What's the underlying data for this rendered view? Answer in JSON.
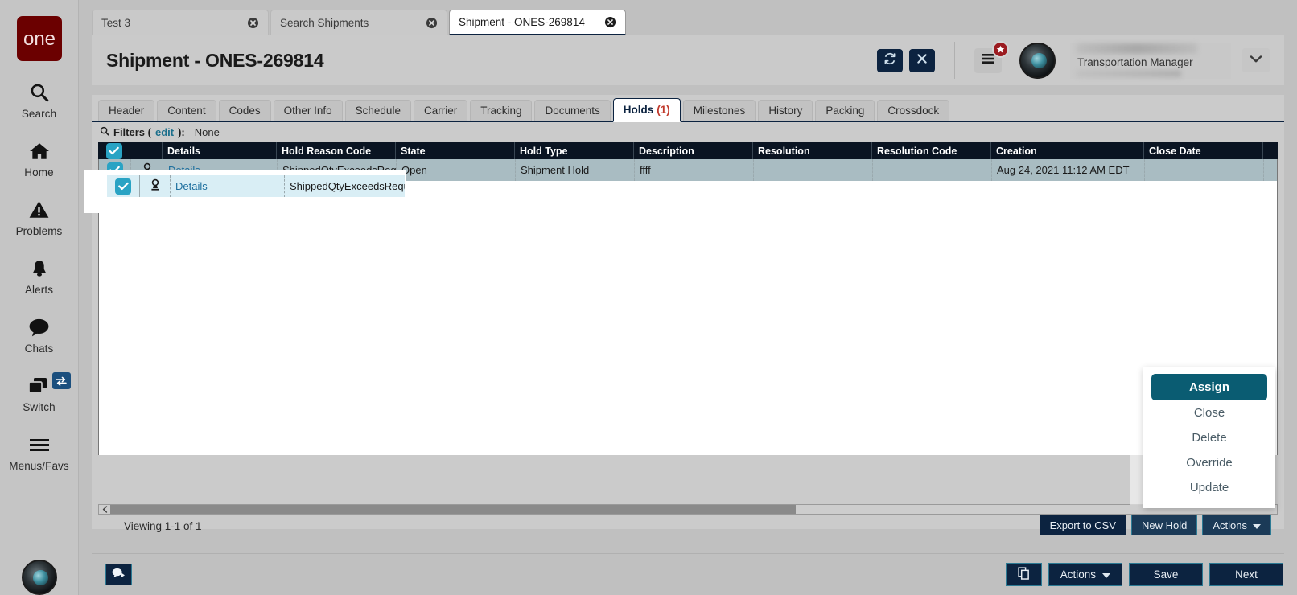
{
  "rail": {
    "logo_text": "one",
    "items": [
      {
        "label": "Search",
        "icon": "search-icon"
      },
      {
        "label": "Home",
        "icon": "home-icon"
      },
      {
        "label": "Problems",
        "icon": "warning-triangle-icon"
      },
      {
        "label": "Alerts",
        "icon": "bell-icon"
      },
      {
        "label": "Chats",
        "icon": "chat-bubble-icon"
      },
      {
        "label": "Switch",
        "icon": "windows-stack-icon",
        "badge_icon": "swap-arrows-icon"
      },
      {
        "label": "Menus/Favs",
        "icon": "hamburger-icon"
      }
    ],
    "bottom_icon": "user-avatar-icon"
  },
  "browser_tabs": [
    {
      "label": "Test 3",
      "active": false
    },
    {
      "label": "Search Shipments",
      "active": false
    },
    {
      "label": "Shipment - ONES-269814",
      "active": true
    }
  ],
  "header": {
    "title": "Shipment - ONES-269814",
    "refresh_icon": "refresh-icon",
    "close_icon": "close-x-icon",
    "menu_icon": "hamburger-menu-icon",
    "badge_icon": "star-badge-icon",
    "avatar_icon": "user-avatar-icon",
    "user_role": "Transportation Manager",
    "caret_icon": "chevron-down-icon"
  },
  "tabs": [
    {
      "label": "Header",
      "active": false,
      "count": ""
    },
    {
      "label": "Content",
      "active": false,
      "count": ""
    },
    {
      "label": "Codes",
      "active": false,
      "count": ""
    },
    {
      "label": "Other Info",
      "active": false,
      "count": ""
    },
    {
      "label": "Schedule",
      "active": false,
      "count": ""
    },
    {
      "label": "Carrier",
      "active": false,
      "count": ""
    },
    {
      "label": "Tracking",
      "active": false,
      "count": ""
    },
    {
      "label": "Documents",
      "active": false,
      "count": ""
    },
    {
      "label": "Holds",
      "active": true,
      "count": "(1)"
    },
    {
      "label": "Milestones",
      "active": false,
      "count": ""
    },
    {
      "label": "History",
      "active": false,
      "count": ""
    },
    {
      "label": "Packing",
      "active": false,
      "count": ""
    },
    {
      "label": "Crossdock",
      "active": false,
      "count": ""
    }
  ],
  "filters": {
    "icon": "search-icon",
    "label": "Filters (",
    "edit_link": "edit",
    "label_end": "):",
    "value": "None"
  },
  "grid": {
    "columns": [
      "Details",
      "Hold Reason Code",
      "State",
      "Hold Type",
      "Description",
      "Resolution",
      "Resolution Code",
      "Creation",
      "Close Date"
    ],
    "header_checkbox_checked": true,
    "rows": [
      {
        "checked": true,
        "row_icon": "stamp-icon",
        "details": "Details",
        "hold_reason_code": "ShippedQtyExceedsRequ...",
        "state": "Open",
        "hold_type": "Shipment Hold",
        "description": "ffff",
        "resolution": "",
        "resolution_code": "",
        "creation": "Aug 24, 2021 11:12 AM EDT",
        "close_date": ""
      }
    ],
    "viewing": "Viewing 1-1 of 1",
    "actions": {
      "export_label": "Export to CSV",
      "new_hold_label": "New Hold",
      "actions_label": "Actions",
      "caret_icon": "chevron-down-icon"
    },
    "scroll_left_icon": "chevron-left-icon"
  },
  "dropdown": {
    "items": [
      {
        "label": "Assign",
        "selected": true
      },
      {
        "label": "Close",
        "selected": false
      },
      {
        "label": "Delete",
        "selected": false
      },
      {
        "label": "Override",
        "selected": false
      },
      {
        "label": "Update",
        "selected": false
      }
    ]
  },
  "bottom_bar": {
    "chat_icon": "chat-play-icon",
    "copy_icon": "copy-pages-icon",
    "actions_label": "Actions",
    "caret_icon": "chevron-down-icon",
    "save_label": "Save",
    "next_label": "Next"
  },
  "colors": {
    "brand_maroon": "#6b0000",
    "navy": "#0c2340",
    "teal_accent": "#0a5c72",
    "checkbox_blue": "#29a3c4",
    "link": "#1d6f9e",
    "count_red": "#c0392b",
    "row_selected": "#a9bcc2"
  }
}
